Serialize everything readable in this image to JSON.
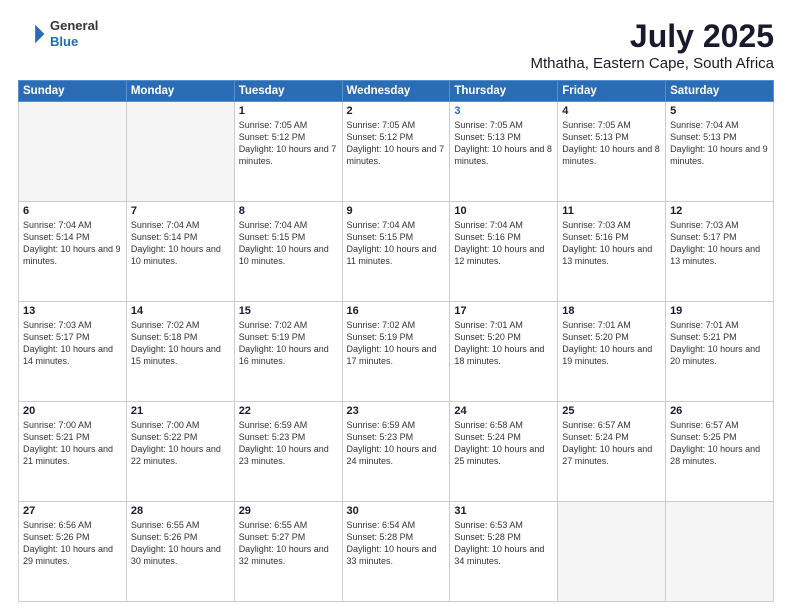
{
  "header": {
    "logo_general": "General",
    "logo_blue": "Blue",
    "title": "July 2025",
    "subtitle": "Mthatha, Eastern Cape, South Africa"
  },
  "days_of_week": [
    "Sunday",
    "Monday",
    "Tuesday",
    "Wednesday",
    "Thursday",
    "Friday",
    "Saturday"
  ],
  "weeks": [
    [
      {
        "day": "",
        "empty": true
      },
      {
        "day": "",
        "empty": true
      },
      {
        "day": "1",
        "sunrise": "Sunrise: 7:05 AM",
        "sunset": "Sunset: 5:12 PM",
        "daylight": "Daylight: 10 hours and 7 minutes."
      },
      {
        "day": "2",
        "sunrise": "Sunrise: 7:05 AM",
        "sunset": "Sunset: 5:12 PM",
        "daylight": "Daylight: 10 hours and 7 minutes."
      },
      {
        "day": "3",
        "sunrise": "Sunrise: 7:05 AM",
        "sunset": "Sunset: 5:13 PM",
        "daylight": "Daylight: 10 hours and 8 minutes.",
        "thursday": true
      },
      {
        "day": "4",
        "sunrise": "Sunrise: 7:05 AM",
        "sunset": "Sunset: 5:13 PM",
        "daylight": "Daylight: 10 hours and 8 minutes."
      },
      {
        "day": "5",
        "sunrise": "Sunrise: 7:04 AM",
        "sunset": "Sunset: 5:13 PM",
        "daylight": "Daylight: 10 hours and 9 minutes."
      }
    ],
    [
      {
        "day": "6",
        "sunrise": "Sunrise: 7:04 AM",
        "sunset": "Sunset: 5:14 PM",
        "daylight": "Daylight: 10 hours and 9 minutes."
      },
      {
        "day": "7",
        "sunrise": "Sunrise: 7:04 AM",
        "sunset": "Sunset: 5:14 PM",
        "daylight": "Daylight: 10 hours and 10 minutes."
      },
      {
        "day": "8",
        "sunrise": "Sunrise: 7:04 AM",
        "sunset": "Sunset: 5:15 PM",
        "daylight": "Daylight: 10 hours and 10 minutes."
      },
      {
        "day": "9",
        "sunrise": "Sunrise: 7:04 AM",
        "sunset": "Sunset: 5:15 PM",
        "daylight": "Daylight: 10 hours and 11 minutes."
      },
      {
        "day": "10",
        "sunrise": "Sunrise: 7:04 AM",
        "sunset": "Sunset: 5:16 PM",
        "daylight": "Daylight: 10 hours and 12 minutes."
      },
      {
        "day": "11",
        "sunrise": "Sunrise: 7:03 AM",
        "sunset": "Sunset: 5:16 PM",
        "daylight": "Daylight: 10 hours and 13 minutes."
      },
      {
        "day": "12",
        "sunrise": "Sunrise: 7:03 AM",
        "sunset": "Sunset: 5:17 PM",
        "daylight": "Daylight: 10 hours and 13 minutes."
      }
    ],
    [
      {
        "day": "13",
        "sunrise": "Sunrise: 7:03 AM",
        "sunset": "Sunset: 5:17 PM",
        "daylight": "Daylight: 10 hours and 14 minutes."
      },
      {
        "day": "14",
        "sunrise": "Sunrise: 7:02 AM",
        "sunset": "Sunset: 5:18 PM",
        "daylight": "Daylight: 10 hours and 15 minutes."
      },
      {
        "day": "15",
        "sunrise": "Sunrise: 7:02 AM",
        "sunset": "Sunset: 5:19 PM",
        "daylight": "Daylight: 10 hours and 16 minutes."
      },
      {
        "day": "16",
        "sunrise": "Sunrise: 7:02 AM",
        "sunset": "Sunset: 5:19 PM",
        "daylight": "Daylight: 10 hours and 17 minutes."
      },
      {
        "day": "17",
        "sunrise": "Sunrise: 7:01 AM",
        "sunset": "Sunset: 5:20 PM",
        "daylight": "Daylight: 10 hours and 18 minutes."
      },
      {
        "day": "18",
        "sunrise": "Sunrise: 7:01 AM",
        "sunset": "Sunset: 5:20 PM",
        "daylight": "Daylight: 10 hours and 19 minutes."
      },
      {
        "day": "19",
        "sunrise": "Sunrise: 7:01 AM",
        "sunset": "Sunset: 5:21 PM",
        "daylight": "Daylight: 10 hours and 20 minutes."
      }
    ],
    [
      {
        "day": "20",
        "sunrise": "Sunrise: 7:00 AM",
        "sunset": "Sunset: 5:21 PM",
        "daylight": "Daylight: 10 hours and 21 minutes."
      },
      {
        "day": "21",
        "sunrise": "Sunrise: 7:00 AM",
        "sunset": "Sunset: 5:22 PM",
        "daylight": "Daylight: 10 hours and 22 minutes."
      },
      {
        "day": "22",
        "sunrise": "Sunrise: 6:59 AM",
        "sunset": "Sunset: 5:23 PM",
        "daylight": "Daylight: 10 hours and 23 minutes."
      },
      {
        "day": "23",
        "sunrise": "Sunrise: 6:59 AM",
        "sunset": "Sunset: 5:23 PM",
        "daylight": "Daylight: 10 hours and 24 minutes."
      },
      {
        "day": "24",
        "sunrise": "Sunrise: 6:58 AM",
        "sunset": "Sunset: 5:24 PM",
        "daylight": "Daylight: 10 hours and 25 minutes."
      },
      {
        "day": "25",
        "sunrise": "Sunrise: 6:57 AM",
        "sunset": "Sunset: 5:24 PM",
        "daylight": "Daylight: 10 hours and 27 minutes."
      },
      {
        "day": "26",
        "sunrise": "Sunrise: 6:57 AM",
        "sunset": "Sunset: 5:25 PM",
        "daylight": "Daylight: 10 hours and 28 minutes."
      }
    ],
    [
      {
        "day": "27",
        "sunrise": "Sunrise: 6:56 AM",
        "sunset": "Sunset: 5:26 PM",
        "daylight": "Daylight: 10 hours and 29 minutes."
      },
      {
        "day": "28",
        "sunrise": "Sunrise: 6:55 AM",
        "sunset": "Sunset: 5:26 PM",
        "daylight": "Daylight: 10 hours and 30 minutes."
      },
      {
        "day": "29",
        "sunrise": "Sunrise: 6:55 AM",
        "sunset": "Sunset: 5:27 PM",
        "daylight": "Daylight: 10 hours and 32 minutes."
      },
      {
        "day": "30",
        "sunrise": "Sunrise: 6:54 AM",
        "sunset": "Sunset: 5:28 PM",
        "daylight": "Daylight: 10 hours and 33 minutes."
      },
      {
        "day": "31",
        "sunrise": "Sunrise: 6:53 AM",
        "sunset": "Sunset: 5:28 PM",
        "daylight": "Daylight: 10 hours and 34 minutes."
      },
      {
        "day": "",
        "empty": true
      },
      {
        "day": "",
        "empty": true
      }
    ]
  ]
}
